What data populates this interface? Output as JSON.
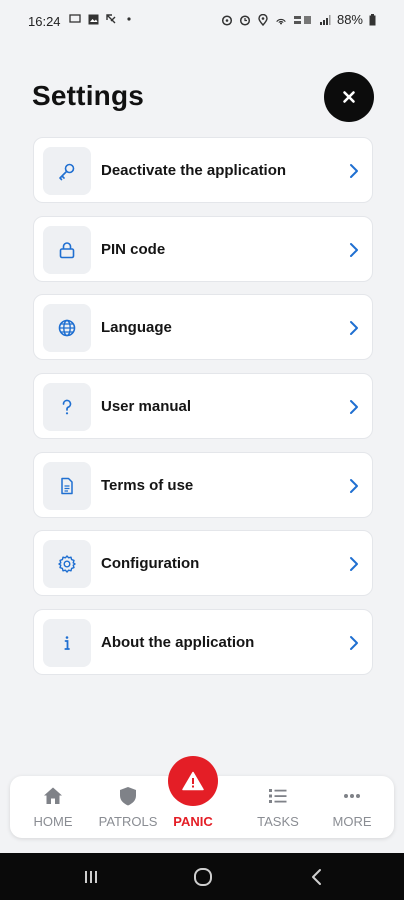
{
  "status_bar": {
    "time": "16:24",
    "battery": "88%",
    "left_icons": [
      "cast-icon",
      "image-icon",
      "missed-call-icon",
      "dot-icon"
    ],
    "right_icons": [
      "alarm-icon",
      "clock-icon",
      "location-icon",
      "hotspot-icon",
      "volte-icon",
      "signal-icon",
      "battery-icon"
    ]
  },
  "header": {
    "title": "Settings",
    "close_icon": "close-icon"
  },
  "settings": {
    "items": [
      {
        "label": "Deactivate the application",
        "icon": "key-icon"
      },
      {
        "label": "PIN code",
        "icon": "lock-icon"
      },
      {
        "label": "Language",
        "icon": "globe-icon"
      },
      {
        "label": "User manual",
        "icon": "question-icon"
      },
      {
        "label": "Terms of use",
        "icon": "document-icon"
      },
      {
        "label": "Configuration",
        "icon": "gear-icon"
      },
      {
        "label": "About the application",
        "icon": "info-icon"
      }
    ],
    "chevron_icon": "chevron-right-icon"
  },
  "bottom_nav": {
    "home": "HOME",
    "patrols": "PATROLS",
    "panic": "PANIC",
    "tasks": "TASKS",
    "more": "MORE"
  },
  "colors": {
    "accent_blue": "#1f6fd1",
    "panic_red": "#e41e26",
    "nav_gray": "#8a8d93",
    "background": "#f2f3f5"
  }
}
